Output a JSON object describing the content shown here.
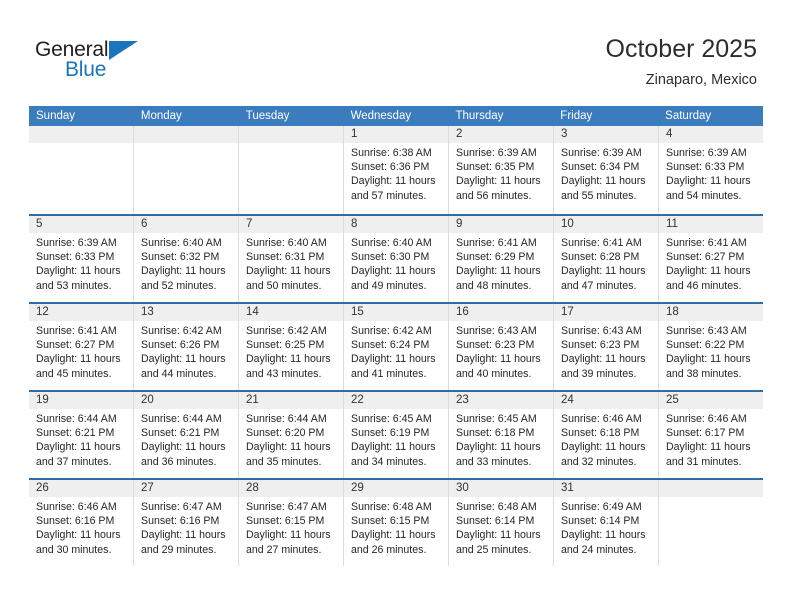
{
  "brand": {
    "name_part1": "General",
    "name_part2": "Blue"
  },
  "header": {
    "title": "October 2025",
    "subtitle": "Zinaparo, Mexico"
  },
  "colors": {
    "header_blue": "#3a7cbe",
    "separator_blue": "#2f6cab",
    "daynum_band": "#efefef",
    "brand_blue": "#1b75bb"
  },
  "weekdays": [
    "Sunday",
    "Monday",
    "Tuesday",
    "Wednesday",
    "Thursday",
    "Friday",
    "Saturday"
  ],
  "labels": {
    "sunrise_prefix": "Sunrise:",
    "sunset_prefix": "Sunset:",
    "daylight_prefix": "Daylight:"
  },
  "weeks": [
    [
      {
        "empty": true
      },
      {
        "empty": true
      },
      {
        "empty": true
      },
      {
        "day": "1",
        "sunrise": "Sunrise: 6:38 AM",
        "sunset": "Sunset: 6:36 PM",
        "daylight_line1": "Daylight: 11 hours",
        "daylight_line2": "and 57 minutes."
      },
      {
        "day": "2",
        "sunrise": "Sunrise: 6:39 AM",
        "sunset": "Sunset: 6:35 PM",
        "daylight_line1": "Daylight: 11 hours",
        "daylight_line2": "and 56 minutes."
      },
      {
        "day": "3",
        "sunrise": "Sunrise: 6:39 AM",
        "sunset": "Sunset: 6:34 PM",
        "daylight_line1": "Daylight: 11 hours",
        "daylight_line2": "and 55 minutes."
      },
      {
        "day": "4",
        "sunrise": "Sunrise: 6:39 AM",
        "sunset": "Sunset: 6:33 PM",
        "daylight_line1": "Daylight: 11 hours",
        "daylight_line2": "and 54 minutes."
      }
    ],
    [
      {
        "day": "5",
        "sunrise": "Sunrise: 6:39 AM",
        "sunset": "Sunset: 6:33 PM",
        "daylight_line1": "Daylight: 11 hours",
        "daylight_line2": "and 53 minutes."
      },
      {
        "day": "6",
        "sunrise": "Sunrise: 6:40 AM",
        "sunset": "Sunset: 6:32 PM",
        "daylight_line1": "Daylight: 11 hours",
        "daylight_line2": "and 52 minutes."
      },
      {
        "day": "7",
        "sunrise": "Sunrise: 6:40 AM",
        "sunset": "Sunset: 6:31 PM",
        "daylight_line1": "Daylight: 11 hours",
        "daylight_line2": "and 50 minutes."
      },
      {
        "day": "8",
        "sunrise": "Sunrise: 6:40 AM",
        "sunset": "Sunset: 6:30 PM",
        "daylight_line1": "Daylight: 11 hours",
        "daylight_line2": "and 49 minutes."
      },
      {
        "day": "9",
        "sunrise": "Sunrise: 6:41 AM",
        "sunset": "Sunset: 6:29 PM",
        "daylight_line1": "Daylight: 11 hours",
        "daylight_line2": "and 48 minutes."
      },
      {
        "day": "10",
        "sunrise": "Sunrise: 6:41 AM",
        "sunset": "Sunset: 6:28 PM",
        "daylight_line1": "Daylight: 11 hours",
        "daylight_line2": "and 47 minutes."
      },
      {
        "day": "11",
        "sunrise": "Sunrise: 6:41 AM",
        "sunset": "Sunset: 6:27 PM",
        "daylight_line1": "Daylight: 11 hours",
        "daylight_line2": "and 46 minutes."
      }
    ],
    [
      {
        "day": "12",
        "sunrise": "Sunrise: 6:41 AM",
        "sunset": "Sunset: 6:27 PM",
        "daylight_line1": "Daylight: 11 hours",
        "daylight_line2": "and 45 minutes."
      },
      {
        "day": "13",
        "sunrise": "Sunrise: 6:42 AM",
        "sunset": "Sunset: 6:26 PM",
        "daylight_line1": "Daylight: 11 hours",
        "daylight_line2": "and 44 minutes."
      },
      {
        "day": "14",
        "sunrise": "Sunrise: 6:42 AM",
        "sunset": "Sunset: 6:25 PM",
        "daylight_line1": "Daylight: 11 hours",
        "daylight_line2": "and 43 minutes."
      },
      {
        "day": "15",
        "sunrise": "Sunrise: 6:42 AM",
        "sunset": "Sunset: 6:24 PM",
        "daylight_line1": "Daylight: 11 hours",
        "daylight_line2": "and 41 minutes."
      },
      {
        "day": "16",
        "sunrise": "Sunrise: 6:43 AM",
        "sunset": "Sunset: 6:23 PM",
        "daylight_line1": "Daylight: 11 hours",
        "daylight_line2": "and 40 minutes."
      },
      {
        "day": "17",
        "sunrise": "Sunrise: 6:43 AM",
        "sunset": "Sunset: 6:23 PM",
        "daylight_line1": "Daylight: 11 hours",
        "daylight_line2": "and 39 minutes."
      },
      {
        "day": "18",
        "sunrise": "Sunrise: 6:43 AM",
        "sunset": "Sunset: 6:22 PM",
        "daylight_line1": "Daylight: 11 hours",
        "daylight_line2": "and 38 minutes."
      }
    ],
    [
      {
        "day": "19",
        "sunrise": "Sunrise: 6:44 AM",
        "sunset": "Sunset: 6:21 PM",
        "daylight_line1": "Daylight: 11 hours",
        "daylight_line2": "and 37 minutes."
      },
      {
        "day": "20",
        "sunrise": "Sunrise: 6:44 AM",
        "sunset": "Sunset: 6:21 PM",
        "daylight_line1": "Daylight: 11 hours",
        "daylight_line2": "and 36 minutes."
      },
      {
        "day": "21",
        "sunrise": "Sunrise: 6:44 AM",
        "sunset": "Sunset: 6:20 PM",
        "daylight_line1": "Daylight: 11 hours",
        "daylight_line2": "and 35 minutes."
      },
      {
        "day": "22",
        "sunrise": "Sunrise: 6:45 AM",
        "sunset": "Sunset: 6:19 PM",
        "daylight_line1": "Daylight: 11 hours",
        "daylight_line2": "and 34 minutes."
      },
      {
        "day": "23",
        "sunrise": "Sunrise: 6:45 AM",
        "sunset": "Sunset: 6:18 PM",
        "daylight_line1": "Daylight: 11 hours",
        "daylight_line2": "and 33 minutes."
      },
      {
        "day": "24",
        "sunrise": "Sunrise: 6:46 AM",
        "sunset": "Sunset: 6:18 PM",
        "daylight_line1": "Daylight: 11 hours",
        "daylight_line2": "and 32 minutes."
      },
      {
        "day": "25",
        "sunrise": "Sunrise: 6:46 AM",
        "sunset": "Sunset: 6:17 PM",
        "daylight_line1": "Daylight: 11 hours",
        "daylight_line2": "and 31 minutes."
      }
    ],
    [
      {
        "day": "26",
        "sunrise": "Sunrise: 6:46 AM",
        "sunset": "Sunset: 6:16 PM",
        "daylight_line1": "Daylight: 11 hours",
        "daylight_line2": "and 30 minutes."
      },
      {
        "day": "27",
        "sunrise": "Sunrise: 6:47 AM",
        "sunset": "Sunset: 6:16 PM",
        "daylight_line1": "Daylight: 11 hours",
        "daylight_line2": "and 29 minutes."
      },
      {
        "day": "28",
        "sunrise": "Sunrise: 6:47 AM",
        "sunset": "Sunset: 6:15 PM",
        "daylight_line1": "Daylight: 11 hours",
        "daylight_line2": "and 27 minutes."
      },
      {
        "day": "29",
        "sunrise": "Sunrise: 6:48 AM",
        "sunset": "Sunset: 6:15 PM",
        "daylight_line1": "Daylight: 11 hours",
        "daylight_line2": "and 26 minutes."
      },
      {
        "day": "30",
        "sunrise": "Sunrise: 6:48 AM",
        "sunset": "Sunset: 6:14 PM",
        "daylight_line1": "Daylight: 11 hours",
        "daylight_line2": "and 25 minutes."
      },
      {
        "day": "31",
        "sunrise": "Sunrise: 6:49 AM",
        "sunset": "Sunset: 6:14 PM",
        "daylight_line1": "Daylight: 11 hours",
        "daylight_line2": "and 24 minutes."
      },
      {
        "empty": true
      }
    ]
  ]
}
